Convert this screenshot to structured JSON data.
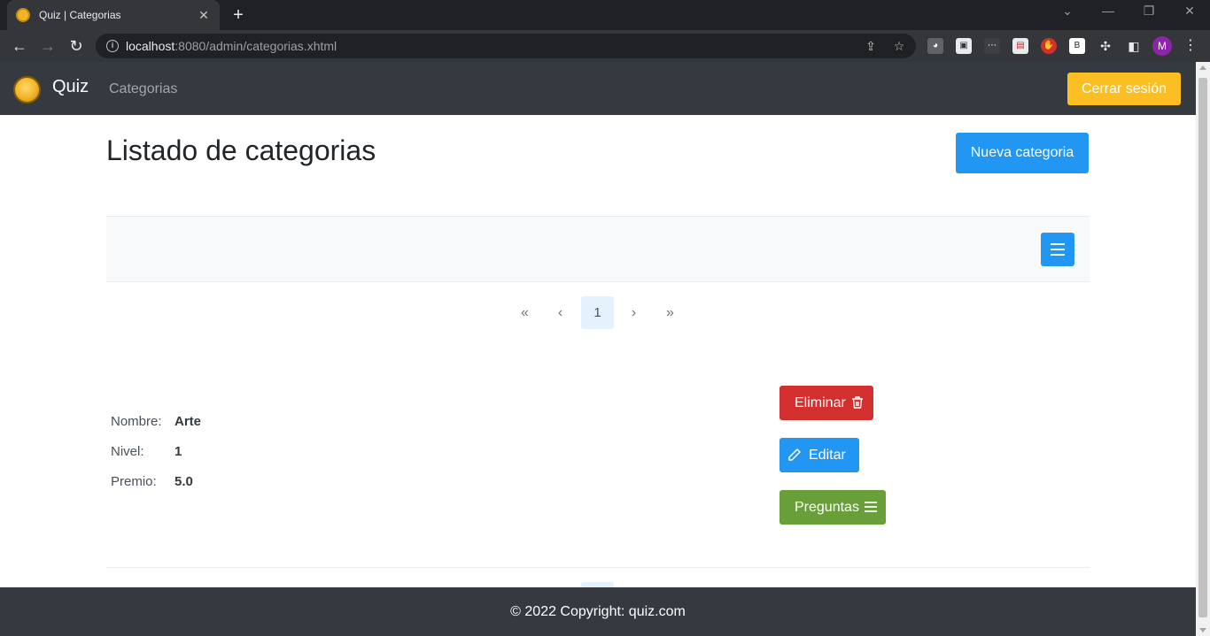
{
  "browser": {
    "tab_title": "Quiz | Categorias",
    "url_host": "localhost",
    "url_rest": ":8080/admin/categorias.xhtml",
    "profile_initial": "M",
    "ext_b_label": "B"
  },
  "navbar": {
    "brand": "Quiz",
    "link_categorias": "Categorias",
    "logout_label": "Cerrar sesión"
  },
  "page": {
    "title": "Listado de categorias",
    "new_button_label": "Nueva categoria"
  },
  "paginator": {
    "current_page": "1"
  },
  "category": {
    "fields": [
      {
        "label": "Nombre:",
        "value": "Arte"
      },
      {
        "label": "Nivel:",
        "value": "1"
      },
      {
        "label": "Premio:",
        "value": "5.0"
      }
    ],
    "actions": {
      "delete_label": "Eliminar",
      "edit_label": "Editar",
      "questions_label": "Preguntas"
    }
  },
  "footer": {
    "text": "© 2022 Copyright: quiz.com"
  },
  "colors": {
    "primary": "#2196f3",
    "danger": "#d32f2f",
    "success": "#689f38",
    "warning": "#fbbf24",
    "navbar": "#343a40"
  }
}
